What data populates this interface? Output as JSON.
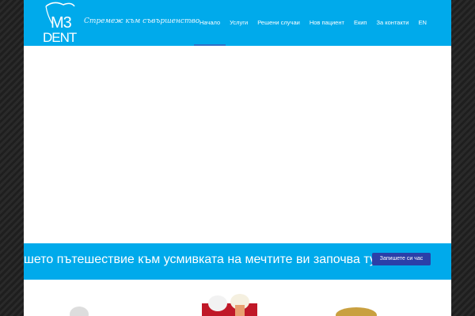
{
  "header": {
    "logo_m3": "M3",
    "logo_dent": "DENT",
    "tagline": "Стремеж към съвършенство",
    "nav": [
      "Начало",
      "Услуги",
      "Решени случаи",
      "Нов пациент",
      "Екип",
      "За контакти",
      "EN"
    ]
  },
  "banner": {
    "text": "шето пътешествие към усмивката на мечтите ви започва тук",
    "button": "Запишете си час"
  },
  "colors": {
    "brand": "#00aaeb",
    "button": "#2b3fa8"
  }
}
